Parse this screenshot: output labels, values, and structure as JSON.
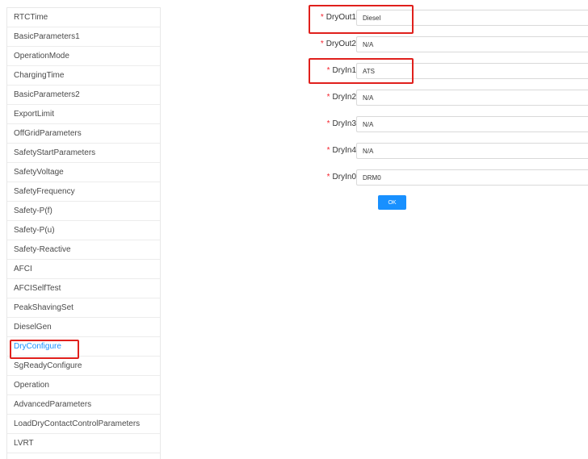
{
  "sidebar": {
    "items": [
      {
        "label": "RTCTime"
      },
      {
        "label": "BasicParameters1"
      },
      {
        "label": "OperationMode"
      },
      {
        "label": "ChargingTime"
      },
      {
        "label": "BasicParameters2"
      },
      {
        "label": "ExportLimit"
      },
      {
        "label": "OffGridParameters"
      },
      {
        "label": "SafetyStartParameters"
      },
      {
        "label": "SafetyVoltage"
      },
      {
        "label": "SafetyFrequency"
      },
      {
        "label": "Safety-P(f)"
      },
      {
        "label": "Safety-P(u)"
      },
      {
        "label": "Safety-Reactive"
      },
      {
        "label": "AFCI"
      },
      {
        "label": "AFCISelfTest"
      },
      {
        "label": "PeakShavingSet"
      },
      {
        "label": "DieselGen"
      },
      {
        "label": "DryConfigure"
      },
      {
        "label": "SgReadyConfigure"
      },
      {
        "label": "Operation"
      },
      {
        "label": "AdvancedParameters"
      },
      {
        "label": "LoadDryContactControlParameters"
      },
      {
        "label": "LVRT"
      }
    ],
    "active": "DryConfigure"
  },
  "form": {
    "required_mark": "*",
    "fields": [
      {
        "label": "DryOut1",
        "value": "Diesel"
      },
      {
        "label": "DryOut2",
        "value": "N/A"
      },
      {
        "label": "DryIn1",
        "value": "ATS"
      },
      {
        "label": "DryIn2",
        "value": "N/A"
      },
      {
        "label": "DryIn3",
        "value": "N/A"
      },
      {
        "label": "DryIn4",
        "value": "N/A"
      },
      {
        "label": "DryIn0",
        "value": "DRM0"
      }
    ],
    "ok_label": "OK"
  },
  "colors": {
    "accent": "#1890ff",
    "highlight": "#e0201c",
    "required": "#f5222d"
  }
}
